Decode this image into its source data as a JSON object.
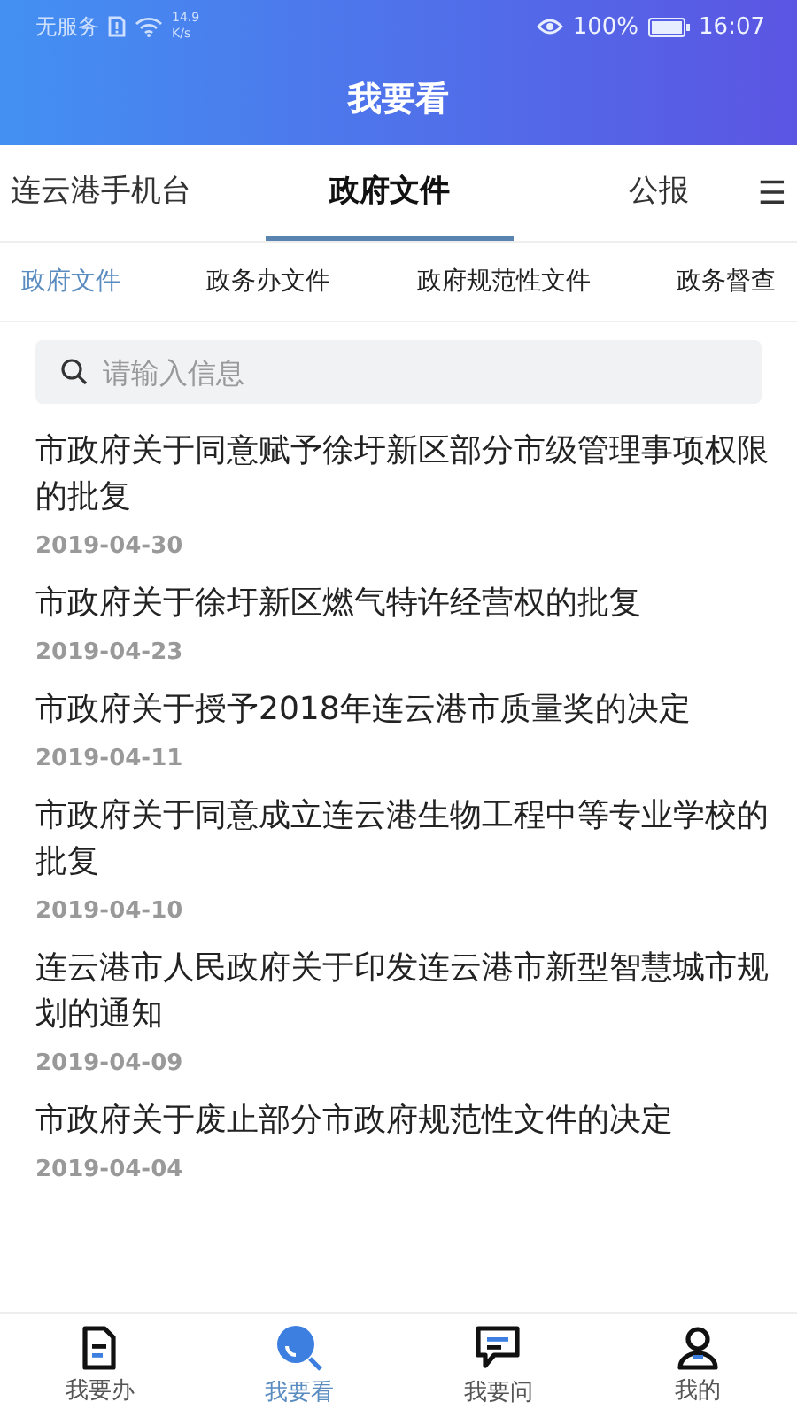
{
  "status_bar": {
    "carrier": "无服务",
    "speed_value": "14.9",
    "speed_unit": "K/s",
    "battery": "100%",
    "time": "16:07"
  },
  "header": {
    "title": "我要看"
  },
  "tabs": [
    {
      "label": "连云港手机台",
      "selected": false
    },
    {
      "label": "政府文件",
      "selected": true
    },
    {
      "label": "公报",
      "selected": false
    }
  ],
  "menu_icon": "☰",
  "sub_tabs": [
    {
      "label": "政府文件",
      "selected": true
    },
    {
      "label": "政务办文件",
      "selected": false
    },
    {
      "label": "政府规范性文件",
      "selected": false
    },
    {
      "label": "政务督查",
      "selected": false
    }
  ],
  "search": {
    "placeholder": "请输入信息"
  },
  "articles": [
    {
      "title": "市政府关于同意赋予徐圩新区部分市级管理事项权限的批复",
      "date": "2019-04-30"
    },
    {
      "title": "市政府关于徐圩新区燃气特许经营权的批复",
      "date": "2019-04-23"
    },
    {
      "title": "市政府关于授予2018年连云港市质量奖的决定",
      "date": "2019-04-11"
    },
    {
      "title": "市政府关于同意成立连云港生物工程中等专业学校的批复",
      "date": "2019-04-10"
    },
    {
      "title": "连云港市人民政府关于印发连云港市新型智慧城市规划的通知",
      "date": "2019-04-09"
    },
    {
      "title": "市政府关于废止部分市政府规范性文件的决定",
      "date": "2019-04-04"
    }
  ],
  "bottom_nav": [
    {
      "label": "我要办",
      "kind": "doc",
      "selected": false
    },
    {
      "label": "我要看",
      "kind": "search",
      "selected": true
    },
    {
      "label": "我要问",
      "kind": "chat",
      "selected": false
    },
    {
      "label": "我的",
      "kind": "user",
      "selected": false
    }
  ]
}
